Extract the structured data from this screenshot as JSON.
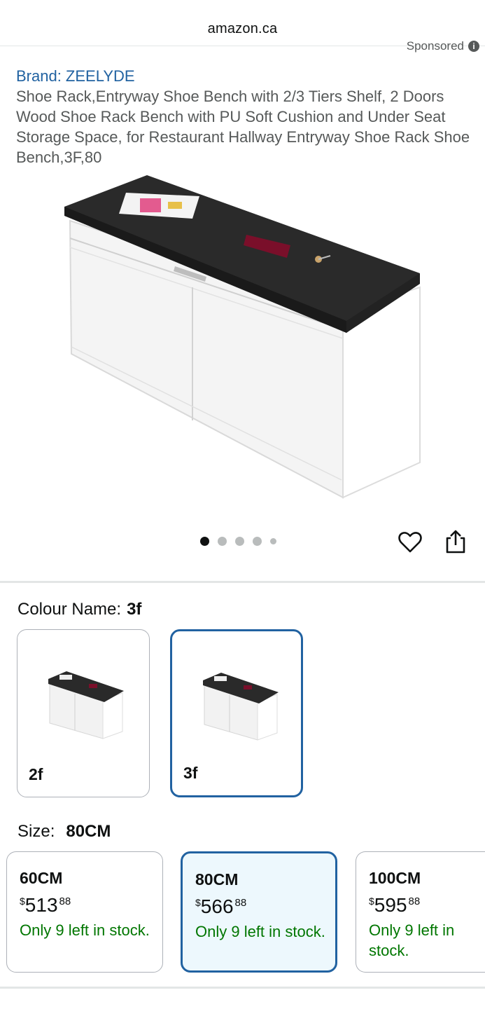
{
  "browser": {
    "url": "amazon.ca"
  },
  "sponsored": {
    "label": "Sponsored"
  },
  "product": {
    "brand": "Brand: ZEELYDE",
    "title": "Shoe Rack,Entryway Shoe Bench with 2/3 Tiers Shelf, 2 Doors Wood Shoe Rack Bench with PU Soft Cushion and Under Seat Storage Space, for Restaurant Hallway Entryway Shoe Rack Shoe Bench,3F,80"
  },
  "gallery": {
    "image_count": 5,
    "active_index": 0
  },
  "colour": {
    "label": "Colour Name:",
    "selected": "3f",
    "options": [
      {
        "label": "2f"
      },
      {
        "label": "3f"
      }
    ]
  },
  "size": {
    "label": "Size:",
    "selected": "80CM",
    "options": [
      {
        "name": "60CM",
        "currency": "$",
        "dollars": "513",
        "cents": "88",
        "stock": "Only 9 left in stock."
      },
      {
        "name": "80CM",
        "currency": "$",
        "dollars": "566",
        "cents": "88",
        "stock": "Only 9 left in stock."
      },
      {
        "name": "100CM",
        "currency": "$",
        "dollars": "595",
        "cents": "88",
        "stock": "Only 9 left in stock."
      }
    ]
  },
  "colors": {
    "link": "#2162a1",
    "stock": "#007600",
    "selected_border": "#2162a1",
    "selected_bg": "#edf8fd"
  },
  "icons": {
    "wishlist": "heart-icon",
    "share": "share-icon",
    "info": "info-icon"
  }
}
